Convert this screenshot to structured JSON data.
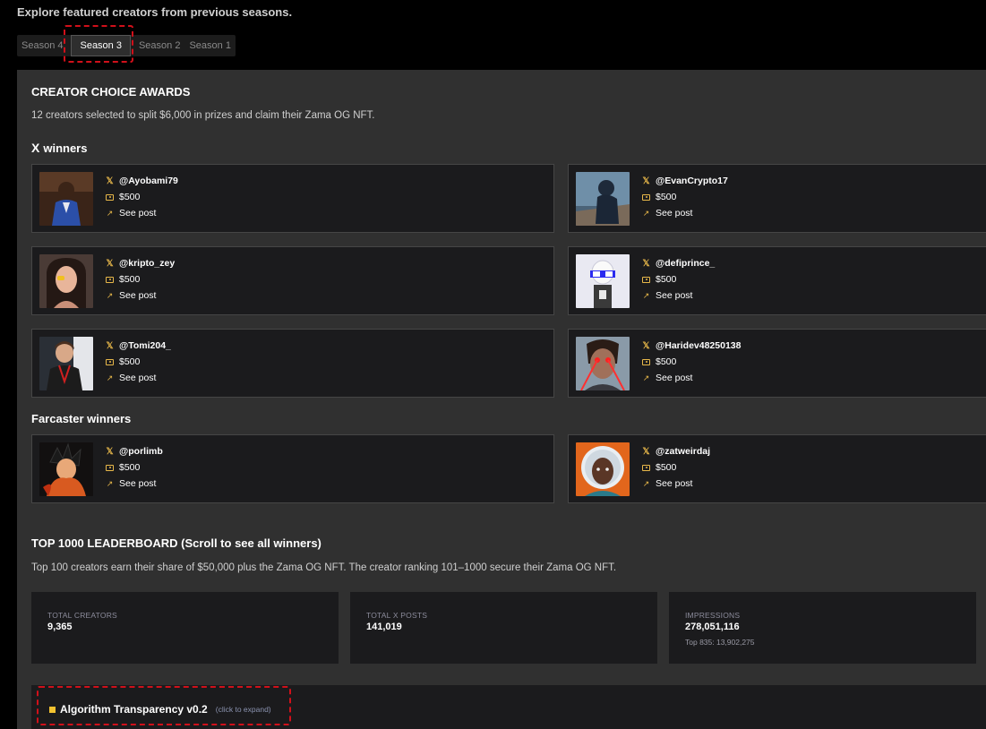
{
  "intro": "Explore featured creators from previous seasons.",
  "tabs": [
    {
      "label": "Season 4",
      "active": false
    },
    {
      "label": "Season 3",
      "active": true
    },
    {
      "label": "Season 2",
      "active": false
    },
    {
      "label": "Season 1",
      "active": false
    }
  ],
  "awards": {
    "title": "CREATOR CHOICE AWARDS",
    "description": "12 creators selected to split $6,000 in prizes and claim their Zama OG NFT.",
    "x_section": "winners",
    "x_glyph": "X",
    "x_winners": [
      {
        "handle": "@Ayobami79",
        "prize": "$500",
        "link": "See post",
        "avatar_icon": "portrait-blue-shirt"
      },
      {
        "handle": "@EvanCrypto17",
        "prize": "$500",
        "link": "See post",
        "avatar_icon": "portrait-hoodie-sea"
      },
      {
        "handle": "@kripto_zey",
        "prize": "$500",
        "link": "See post",
        "avatar_icon": "portrait-woman"
      },
      {
        "handle": "@defiprince_",
        "prize": "$500",
        "link": "See post",
        "avatar_icon": "pixel-art-figure"
      },
      {
        "handle": "@Tomi204_",
        "prize": "$500",
        "link": "See post",
        "avatar_icon": "portrait-lanyard"
      },
      {
        "handle": "@Haridev48250138",
        "prize": "$500",
        "link": "See post",
        "avatar_icon": "portrait-laser-eyes"
      }
    ],
    "farcaster_section": "Farcaster winners",
    "farcaster_winners": [
      {
        "handle": "@porlimb",
        "prize": "$500",
        "link": "See post",
        "avatar_icon": "anime-character"
      },
      {
        "handle": "@zatweirdaj",
        "prize": "$500",
        "link": "See post",
        "avatar_icon": "portrait-headwrap"
      }
    ]
  },
  "leaderboard": {
    "title": "TOP 1000 LEADERBOARD (Scroll to see all winners)",
    "description": "Top 100 creators earn their share of $50,000 plus the Zama OG NFT. The creator ranking 101–1000 secure their Zama OG NFT.",
    "stats": [
      {
        "label": "TOTAL CREATORS",
        "value": "9,365",
        "sub": ""
      },
      {
        "label": "TOTAL X POSTS",
        "value": "141,019",
        "sub": ""
      },
      {
        "label": "IMPRESSIONS",
        "value": "278,051,116",
        "sub": "Top 835: 13,902,275"
      }
    ]
  },
  "algorithm": {
    "title": "Algorithm Transparency v0.2",
    "hint": "(click to expand)"
  },
  "colors": {
    "accent": "#e8b84a",
    "panel": "#303030",
    "card": "#1b1b1d",
    "highlight": "#d0101a"
  },
  "icons": {
    "x": "x-logo-icon",
    "prize": "money-icon",
    "link": "external-link-icon"
  }
}
